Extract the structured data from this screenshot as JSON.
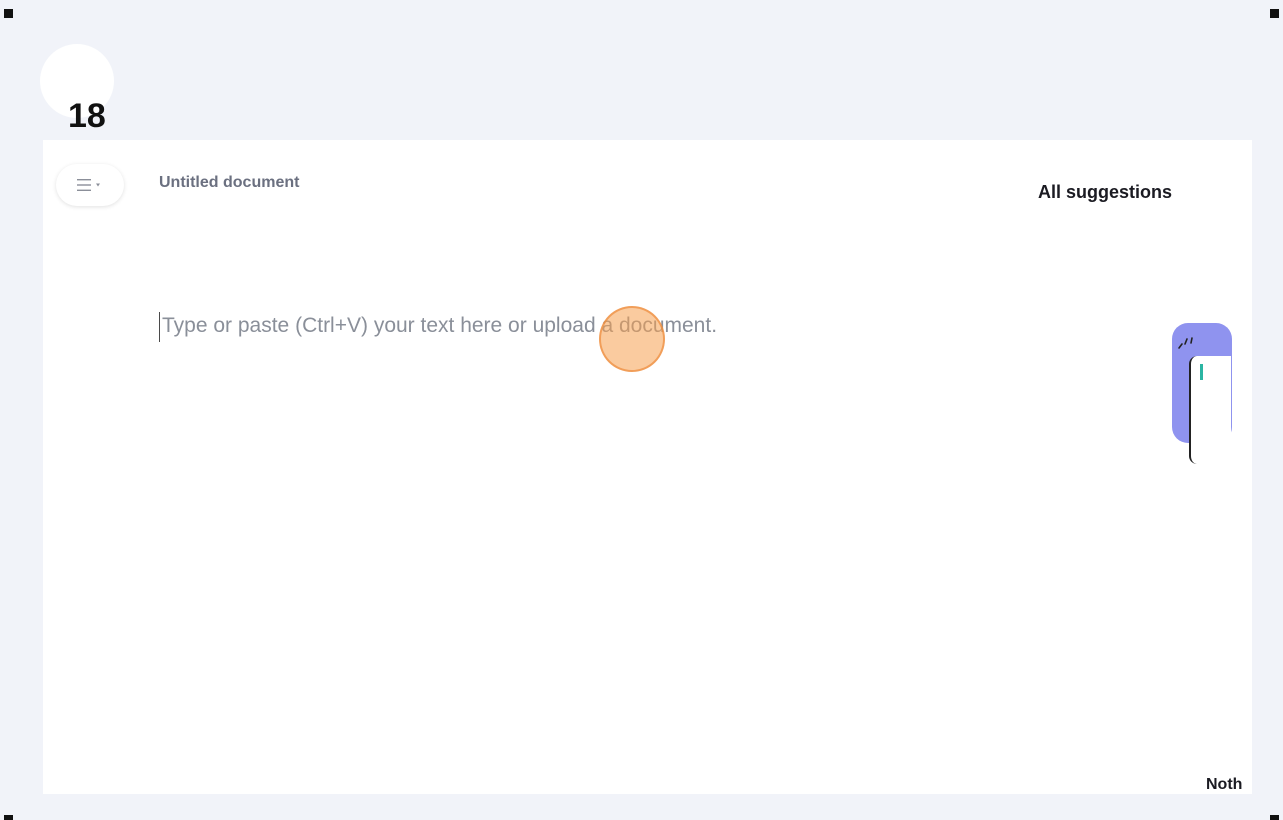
{
  "step": {
    "number": "18"
  },
  "document": {
    "title": "Untitled document",
    "placeholder": "Type or paste (Ctrl+V) your text here or upload a document."
  },
  "suggestions": {
    "title": "All suggestions",
    "empty_text": "Noth"
  },
  "icons": {
    "menu": "menu-icon",
    "assistant": "assistant-widget-icon"
  },
  "colors": {
    "background": "#f1f3f9",
    "panel": "#ffffff",
    "click_marker": "#f5a050",
    "widget": "#8f93ef",
    "accent": "#2bb5a3"
  }
}
